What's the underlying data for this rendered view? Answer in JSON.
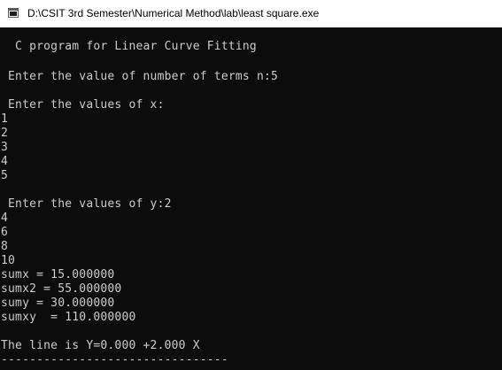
{
  "window": {
    "title": "D:\\CSIT 3rd Semester\\Numerical Method\\lab\\least square.exe",
    "icon": "console-app-icon"
  },
  "console": {
    "lines": [
      "  C program for Linear Curve Fitting",
      " Enter the value of number of terms n:5",
      " Enter the values of x:",
      "1",
      "2",
      "3",
      "4",
      "5",
      " Enter the values of y:2",
      "4",
      "6",
      "8",
      "10",
      "sumx = 15.000000",
      "sumx2 = 55.000000",
      "sumy = 30.000000",
      "sumxy  = 110.000000",
      "The line is Y=0.000 +2.000 X",
      "--------------------------------"
    ]
  },
  "colors": {
    "console_background": "#0c0c0c",
    "console_text": "#cccccc",
    "titlebar_background": "#ffffff"
  }
}
